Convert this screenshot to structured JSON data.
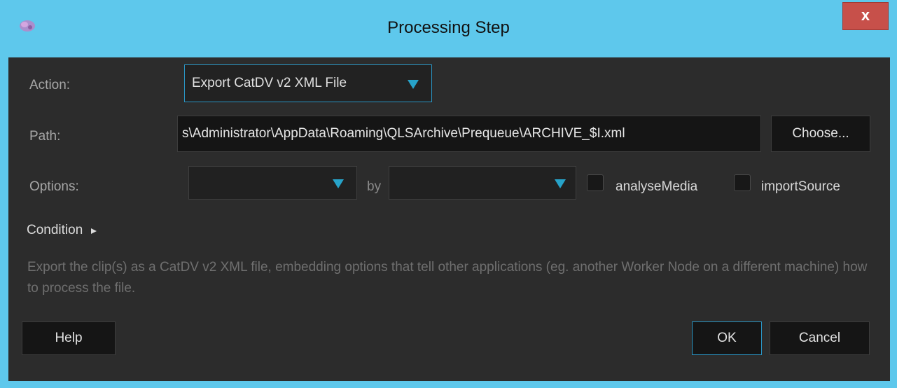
{
  "window": {
    "title": "Processing Step",
    "close_label": "x"
  },
  "form": {
    "action_label": "Action:",
    "action_value": "Export CatDV v2 XML File",
    "path_label": "Path:",
    "path_value": "s\\Administrator\\AppData\\Roaming\\QLSArchive\\Prequeue\\ARCHIVE_$I.xml",
    "choose_label": "Choose...",
    "options_label": "Options:",
    "option1_value": "",
    "by_label": "by",
    "option2_value": "",
    "analyse_label": "analyseMedia",
    "analyse_checked": false,
    "import_label": "importSource",
    "import_checked": false,
    "condition_label": "Condition",
    "description": "Export the clip(s) as a CatDV v2 XML file, embedding options that tell other applications (eg. another Worker Node on a different machine) how to process the file."
  },
  "footer": {
    "help_label": "Help",
    "ok_label": "OK",
    "cancel_label": "Cancel"
  },
  "colors": {
    "titlebar": "#5ec8ec",
    "panel": "#2c2c2c",
    "accent": "#27a3c9",
    "close": "#c7504a"
  }
}
